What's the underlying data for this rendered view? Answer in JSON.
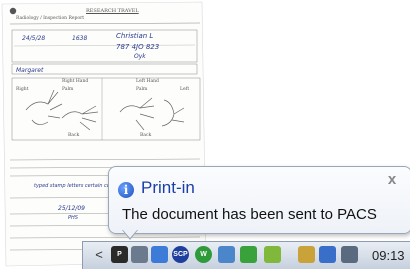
{
  "balloon": {
    "title": "Print-in",
    "message": "The document has been sent to PACS",
    "info_glyph": "i",
    "close_glyph": "x"
  },
  "document": {
    "heading": "RESEARCH TRAVEL",
    "subheading": "Radiology / Inspection Report",
    "labels": {
      "right_hand": "Right Hand",
      "left_hand": "Left Hand",
      "right": "Right",
      "left": "Left",
      "palm": "Palm",
      "back": "Back"
    },
    "handwriting": {
      "date": "24/5/28",
      "time": "1638",
      "patient": "Christian L",
      "number": "787 4JO 823",
      "note": "Oyk",
      "examiner": "Margaret",
      "remarks": "typed stamp letters certain copies",
      "signed_date": "25/12/09",
      "initials": "PHS"
    }
  },
  "taskbar": {
    "tray_arrow": "<",
    "icons": [
      {
        "name": "printer-tray-icon",
        "glyph": "P",
        "color": "#2a2a2a"
      },
      {
        "name": "network-printer-icon",
        "glyph": "",
        "color": "#6b7a8d"
      },
      {
        "name": "monitor-icon",
        "glyph": "",
        "color": "#3d7bd9"
      },
      {
        "name": "scp-icon",
        "glyph": "SCP",
        "color": "#1f3f9e"
      },
      {
        "name": "w-icon",
        "glyph": "W",
        "color": "#2f9a3a"
      },
      {
        "name": "network-icon",
        "glyph": "",
        "color": "#4a86c9"
      },
      {
        "name": "security-icon",
        "glyph": "",
        "color": "#3aa23a"
      },
      {
        "name": "update-icon",
        "glyph": "",
        "color": "#7fb83a"
      },
      {
        "name": "clipboard-icon",
        "glyph": "",
        "color": "#c9a23a"
      },
      {
        "name": "display-icon",
        "glyph": "",
        "color": "#3a6fc9"
      },
      {
        "name": "speaker-icon",
        "glyph": "",
        "color": "#5a6b80"
      }
    ],
    "clock": "09:13"
  }
}
